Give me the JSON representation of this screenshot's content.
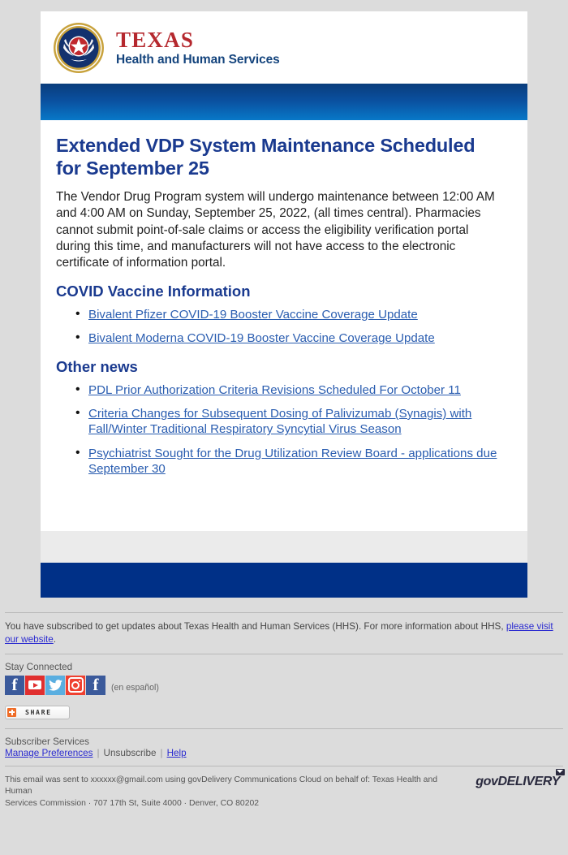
{
  "brand": {
    "seal_icon": "texas-state-seal-icon",
    "texas": "TEXAS",
    "agency": "Health and Human Services"
  },
  "article": {
    "title": "Extended VDP System Maintenance Scheduled for September 25",
    "body": "The Vendor Drug Program system will undergo maintenance between 12:00 AM and 4:00 AM on Sunday, September 25, 2022, (all times central). Pharmacies cannot submit point-of-sale claims or access the eligibility verification portal during this time, and manufacturers will not have access to the electronic certificate of information portal.",
    "covid_heading": "COVID Vaccine Information",
    "covid_links": [
      "Bivalent Pfizer COVID-19 Booster Vaccine Coverage Update",
      "Bivalent Moderna COVID-19 Booster Vaccine Coverage Update"
    ],
    "other_heading": "Other news",
    "other_links": [
      "PDL Prior Authorization Criteria Revisions Scheduled For October 11",
      "Criteria Changes for Subsequent Dosing of Palivizumab (Synagis) with Fall/Winter Traditional Respiratory Syncytial Virus Season",
      "Psychiatrist Sought for the Drug Utilization Review Board - applications due September 30"
    ]
  },
  "footer": {
    "subscribe_text_before": "You have subscribed to get updates about Texas Health and Human Services (HHS). For more information about HHS, ",
    "subscribe_link": "please visit our website",
    "subscribe_text_after": ".",
    "stay_connected": "Stay Connected",
    "social": [
      {
        "name": "facebook-icon",
        "label": "Facebook"
      },
      {
        "name": "youtube-icon",
        "label": "YouTube"
      },
      {
        "name": "twitter-icon",
        "label": "Twitter"
      },
      {
        "name": "instagram-icon",
        "label": "Instagram"
      },
      {
        "name": "facebook-espanol-icon",
        "label": "Facebook en espanol"
      }
    ],
    "espanol": "(en español)",
    "share_label": "SHARE",
    "subscriber_services": "Subscriber Services",
    "manage_preferences": "Manage Preferences",
    "unsubscribe": "Unsubscribe",
    "help": "Help",
    "separator": "|",
    "legal_line1": "This email was sent to xxxxxx@gmail.com using govDelivery Communications Cloud on behalf of: Texas Health and Human",
    "legal_line2": "Services Commission · 707 17th St, Suite 4000 · Denver, CO 80202",
    "govdelivery": "govDELIVERY"
  },
  "colors": {
    "navy": "#003087",
    "heading_blue": "#1a3a8f",
    "link_blue": "#2a5db0",
    "texas_red": "#b5282e",
    "page_bg": "#dcdcdc",
    "gradient_top": "#0a3d7c",
    "gradient_bottom": "#0878c8",
    "share_orange": "#ef6c27"
  }
}
